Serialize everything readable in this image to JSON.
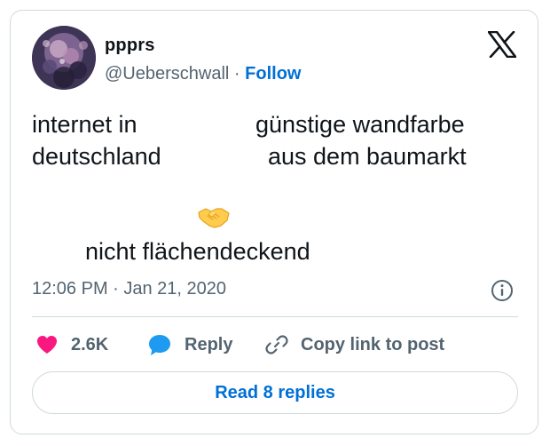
{
  "author": {
    "name": "ppprs",
    "handle": "@Ueberschwall",
    "separator": "·",
    "follow_label": "Follow"
  },
  "tweet": {
    "left_lines": [
      "internet in",
      "deutschland"
    ],
    "right_lines": [
      "günstige wandfarbe",
      "aus dem baumarkt"
    ],
    "emoji": "handshake-emoji",
    "bottom_line": "nicht flächendeckend",
    "timestamp": "12:06 PM · Jan 21, 2020"
  },
  "actions": {
    "like_count": "2.6K",
    "reply_label": "Reply",
    "copy_label": "Copy link to post"
  },
  "read_replies_label": "Read 8 replies",
  "icons": {
    "logo": "x-logo-icon",
    "info": "info-icon",
    "like": "heart-icon",
    "reply": "reply-bubble-icon",
    "copy": "link-icon"
  },
  "colors": {
    "link": "#006fd6",
    "heart": "#f91880",
    "reply_bubble": "#1d9bf0",
    "secondary_text": "#536471",
    "border": "#cfd9de"
  }
}
